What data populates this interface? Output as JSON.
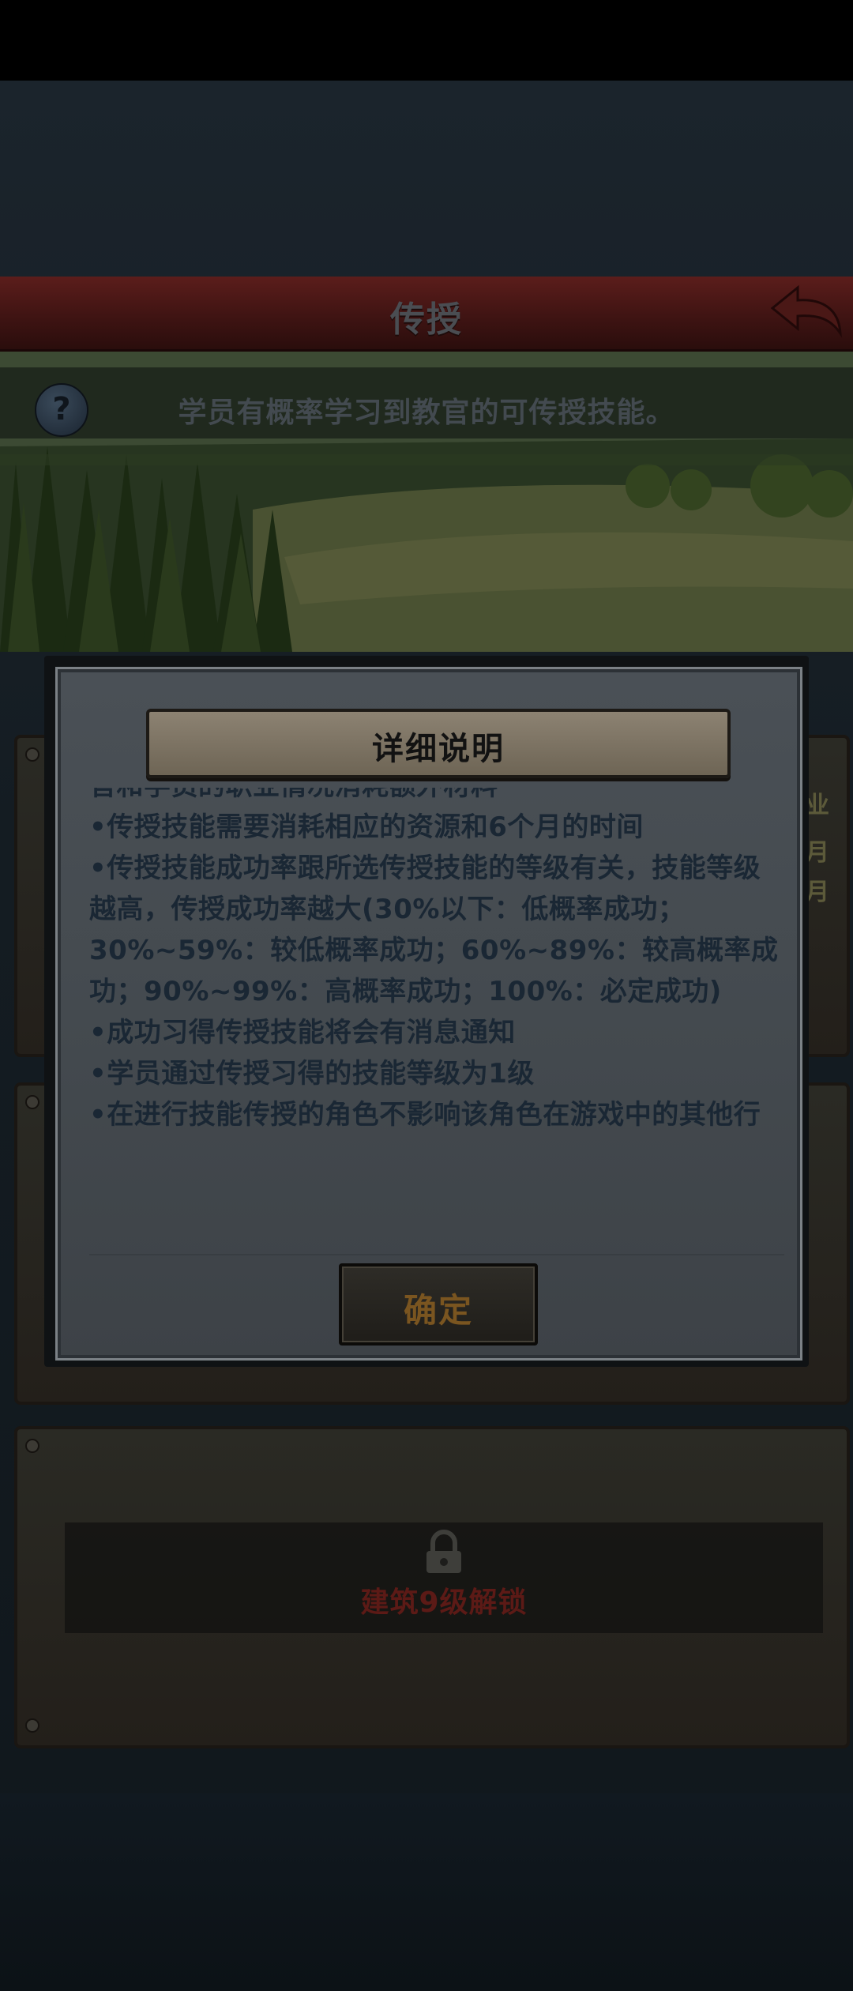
{
  "header": {
    "title": "传授"
  },
  "info": {
    "text": "学员有概率学习到教官的可传授技能。"
  },
  "panels": [
    {
      "side_lines": [
        "业",
        "月",
        "月"
      ]
    },
    {
      "lock_text": "建筑9级解锁"
    }
  ],
  "dialog": {
    "title": "详细说明",
    "paragraphs": [
      "官和学员的职业情况消耗额外材料",
      "•传授技能需要消耗相应的资源和6个月的时间",
      "•传授技能成功率跟所选传授技能的等级有关，技能等级越高，传授成功率越大(30%以下：低概率成功；30%~59%：较低概率成功；60%~89%：较高概率成功；90%~99%：高概率成功；100%：必定成功)",
      "•成功习得传授技能将会有消息通知",
      "•学员通过传授习得的技能等级为1级",
      "•在进行技能传授的角色不影响该角色在游戏中的其他行为"
    ],
    "ok_label": "确定"
  }
}
